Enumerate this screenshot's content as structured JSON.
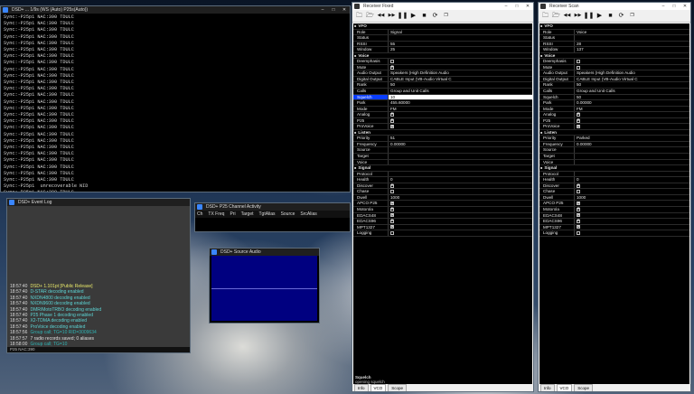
{
  "console": {
    "title": "DSD+ ... 1/9s (WS (Auto) P25s(Auto))",
    "lines": [
      "Sync:-P25p1 NAC:390 TDULC",
      "Sync:-P25p1 NAC:390 TDULC",
      "Sync:-P25p1 NAC:390 TDULC",
      "Sync:-P25p1 NAC:390 TDULC",
      "Sync:-P25p1 NAC:390 TDULC",
      "Sync:-P25p1 NAC:390 TDULC",
      "Sync:-P25p1 NAC:390 TDULC",
      "Sync:-P25p1 NAC:390 TDULC",
      "Sync:-P25p1 NAC:390 TDULC",
      "Sync:-P25p1 NAC:390 TDULC",
      "Sync:-P25p1 NAC:390 TDULC",
      "Sync:-P25p1 NAC:390 TDULC",
      "Sync:-P25p1 NAC:390 TDULC",
      "Sync:-P25p1 NAC:390 TDULC",
      "Sync:-P25p1 NAC:390 TDULC",
      "Sync:-P25p1 NAC:390 TDULC",
      "Sync:-P25p1 NAC:390 TDULC",
      "Sync:-P25p1 NAC:390 TDULC",
      "Sync:-P25p1 NAC:390 TDULC",
      "Sync:-P25p1 NAC:390 TDULC",
      "Sync:-P25p1 NAC:390 TDULC",
      "Sync:-P25p1 NAC:390 TDULC",
      "Sync:-P25p1 NAC:390 TDULC",
      "Sync:-P25p1 NAC:390 TDULC",
      "Sync:-P25p1 NAC:390 TDULC",
      "Sync:-P25p1 NAC:390 TDULC",
      "Sync:-P25p1  unrecoverable NID",
      "Sync:-P25p1 NAC:390 TDULC",
      "Sync: no sync",
      "4 group records saved; 0 aliases"
    ]
  },
  "eventlog": {
    "title": "DSD+ Event Log",
    "entries": [
      {
        "time": "18:57:40",
        "msg": "DSD+ 1.101pt  [Public Release]",
        "color": "c-yellow"
      },
      {
        "time": "18:57:40",
        "msg": "D-STAR decoding enabled",
        "color": ""
      },
      {
        "time": "18:57:40",
        "msg": "NXDN4800 decoding enabled",
        "color": ""
      },
      {
        "time": "18:57:40",
        "msg": "NXDN9600 decoding enabled",
        "color": ""
      },
      {
        "time": "18:57:40",
        "msg": "DMR/MotoTRBO decoding enabled",
        "color": ""
      },
      {
        "time": "18:57:40",
        "msg": "P25 Phase 1 decoding enabled",
        "color": ""
      },
      {
        "time": "18:57:40",
        "msg": "X2-TDMA decoding enabled",
        "color": ""
      },
      {
        "time": "18:57:40",
        "msg": "ProVoice decoding enabled",
        "color": ""
      },
      {
        "time": "18:57:56",
        "msg": "Group call; TG=10  RID=3009634",
        "color": "c-teal"
      },
      {
        "time": "18:57:57",
        "msg": "7 radio records saved; 0 aliases",
        "color": "c-white"
      },
      {
        "time": "18:58:00",
        "msg": "Group call; TG=10",
        "color": "c-teal"
      },
      {
        "time": "18:58:09",
        "msg": "4 group records saved; 0 aliases",
        "color": "c-white"
      }
    ],
    "status": "P25  NAC:390"
  },
  "channel": {
    "title": "DSD+ P25 Channel Activity",
    "columns": [
      "Ch",
      "TX Freq",
      "Pri",
      "Target",
      "TgtAlias",
      "Source",
      "SrcAlias"
    ]
  },
  "srcaudio": {
    "title": "DSD+ Source Audio"
  },
  "rxfixed": {
    "title": "Receiver Fixed",
    "rows": [
      {
        "t": "section",
        "k": "VFO"
      },
      {
        "k": "Role",
        "v": "Signal"
      },
      {
        "k": "Status",
        "v": ""
      },
      {
        "k": "RSSI",
        "v": "55"
      },
      {
        "k": "Window",
        "v": "25"
      },
      {
        "t": "section",
        "k": "Voice"
      },
      {
        "k": "Deemphasis",
        "cb": false
      },
      {
        "k": "Mute",
        "cb": true
      },
      {
        "k": "Audio Output",
        "v": "Speakers (High Definition Audio"
      },
      {
        "k": "Digital Output",
        "v": "CABLE Input (VB-Audio Virtual C"
      },
      {
        "k": "Rank",
        "v": "50"
      },
      {
        "k": "Calls",
        "v": "Group and Unit Calls"
      },
      {
        "k": "Squelch",
        "v": "10",
        "sel": true
      },
      {
        "k": "Park",
        "v": "455.60000"
      },
      {
        "k": "Mode",
        "v": "FM"
      },
      {
        "k": "Analog",
        "cb": true
      },
      {
        "k": "P25",
        "cb": true
      },
      {
        "k": "ProVoice",
        "cb": true
      },
      {
        "t": "section",
        "k": "Listen"
      },
      {
        "k": "Priority",
        "v": "51"
      },
      {
        "k": "Frequency",
        "v": "0.00000"
      },
      {
        "k": "Source",
        "v": ""
      },
      {
        "k": "Target",
        "v": ""
      },
      {
        "k": "Voice",
        "v": ""
      },
      {
        "t": "section",
        "k": "Signal"
      },
      {
        "k": "Protocol",
        "v": ""
      },
      {
        "k": "Health",
        "v": "0"
      },
      {
        "k": "Discover",
        "cb": true
      },
      {
        "k": "Chase",
        "cb": false
      },
      {
        "k": "Dwell",
        "v": "1000"
      },
      {
        "k": "APCO P25",
        "cb": true
      },
      {
        "k": "Motorola",
        "cb": true
      },
      {
        "k": "EDACS48",
        "cb": true
      },
      {
        "k": "EDACS96",
        "cb": true
      },
      {
        "k": "MPT1327",
        "cb": true
      },
      {
        "k": "Logging",
        "cb": false
      }
    ],
    "desc_title": "Squelch",
    "desc_text": "opening squelch",
    "tabs": [
      "Info",
      "VCO",
      "Scope"
    ]
  },
  "rxscan": {
    "title": "Receiver Scan",
    "rows": [
      {
        "t": "section",
        "k": "VFO"
      },
      {
        "k": "Role",
        "v": "Voice"
      },
      {
        "k": "Status",
        "v": ""
      },
      {
        "k": "RSSI",
        "v": "28"
      },
      {
        "k": "Window",
        "v": "137"
      },
      {
        "t": "section",
        "k": "Voice"
      },
      {
        "k": "Deemphasis",
        "cb": false
      },
      {
        "k": "Mute",
        "cb": false
      },
      {
        "k": "Audio Output",
        "v": "Speakers (High Definition Audio"
      },
      {
        "k": "Digital Output",
        "v": "CABLE Input (VB-Audio Virtual C"
      },
      {
        "k": "Rank",
        "v": "50"
      },
      {
        "k": "Calls",
        "v": "Group and Unit Calls"
      },
      {
        "k": "Squelch",
        "v": "50"
      },
      {
        "k": "Park",
        "v": "0.00000"
      },
      {
        "k": "Mode",
        "v": "FM"
      },
      {
        "k": "Analog",
        "cb": true
      },
      {
        "k": "P25",
        "cb": true
      },
      {
        "k": "ProVoice",
        "cb": true
      },
      {
        "t": "section",
        "k": "Listen"
      },
      {
        "k": "Priority",
        "v": "Parked"
      },
      {
        "k": "Frequency",
        "v": "0.00000"
      },
      {
        "k": "Source",
        "v": ""
      },
      {
        "k": "Target",
        "v": ""
      },
      {
        "k": "Voice",
        "v": ""
      },
      {
        "t": "section",
        "k": "Signal"
      },
      {
        "k": "Protocol",
        "v": ""
      },
      {
        "k": "Health",
        "v": "0"
      },
      {
        "k": "Discover",
        "cb": true
      },
      {
        "k": "Chase",
        "cb": false
      },
      {
        "k": "Dwell",
        "v": "1000"
      },
      {
        "k": "APCO P25",
        "cb": true
      },
      {
        "k": "Motorola",
        "cb": true
      },
      {
        "k": "EDACS48",
        "cb": true
      },
      {
        "k": "EDACS96",
        "cb": true
      },
      {
        "k": "MPT1327",
        "cb": true
      },
      {
        "k": "Logging",
        "cb": false
      }
    ],
    "tabs": [
      "Info",
      "VCO",
      "Scope"
    ]
  },
  "toolbar_icons": [
    "folder-icon",
    "open-icon",
    "rewind-icon",
    "fast-forward-icon",
    "pause-icon",
    "play-icon",
    "stop-icon",
    "sync-icon",
    "window-icon"
  ]
}
